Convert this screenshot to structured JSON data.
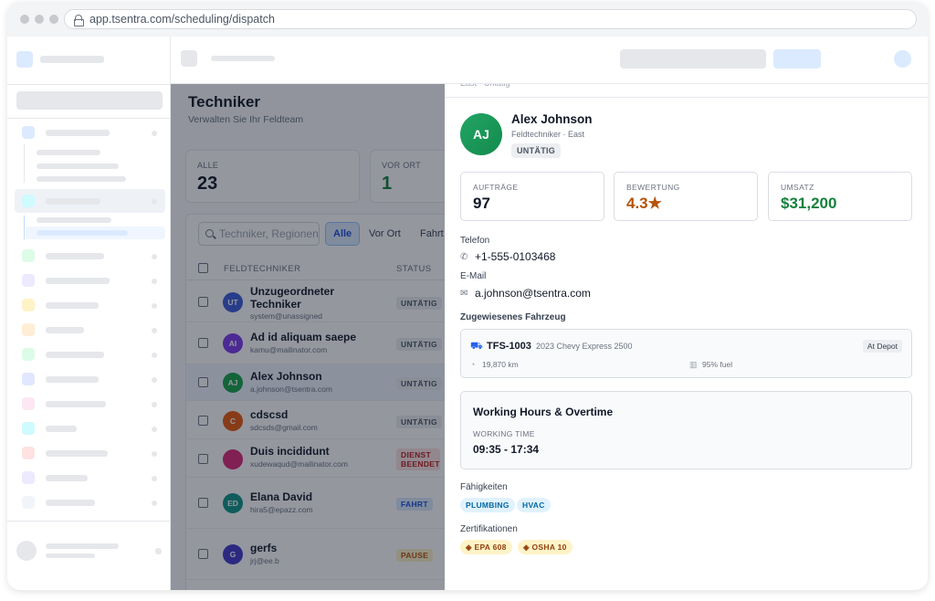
{
  "browser": {
    "url": "app.tsentra.com/scheduling/dispatch"
  },
  "page": {
    "title": "Techniker",
    "subtitle": "Verwalten Sie Ihr Feldteam"
  },
  "stats": [
    {
      "label": "ALLE",
      "value": "23"
    },
    {
      "label": "VOR ORT",
      "value": "1"
    }
  ],
  "search": {
    "placeholder": "Techniker, Regionen"
  },
  "filters": [
    "Alle",
    "Vor Ort",
    "Fahrt"
  ],
  "table": {
    "columns": [
      "FELDTECHNIKER",
      "STATUS"
    ],
    "rows": [
      {
        "initials": "UT",
        "name": "Unzugeordneter Techniker",
        "email": "system@unassigned",
        "status": "UNTÄTIG",
        "avatar_color": "#3b5bdb"
      },
      {
        "initials": "AI",
        "name": "Ad id aliquam saepe",
        "email": "kamu@mailinator.com",
        "status": "UNTÄTIG",
        "avatar_color": "#7c3aed"
      },
      {
        "initials": "AJ",
        "name": "Alex Johnson",
        "email": "a.johnson@tsentra.com",
        "status": "UNTÄTIG",
        "avatar_color": "#16a34a"
      },
      {
        "initials": "C",
        "name": "cdscsd",
        "email": "sdcsds@gmail.com",
        "status": "UNTÄTIG",
        "avatar_color": "#ea580c"
      },
      {
        "initials": "",
        "name": "Duis incididunt",
        "email": "xudewaqud@mailinator.com",
        "status": "DIENST BEENDET",
        "avatar_color": "#db2777"
      },
      {
        "initials": "ED",
        "name": "Elana David",
        "email": "hira5@epazz.com",
        "status": "FAHRT",
        "avatar_color": "#0d9488"
      },
      {
        "initials": "G",
        "name": "gerfs",
        "email": "jrj@ee.b",
        "status": "PAUSE",
        "avatar_color": "#4338ca"
      }
    ]
  },
  "drawer": {
    "header_text": "East · Untätig",
    "initials": "AJ",
    "name": "Alex Johnson",
    "role": "Feldtechniker · East",
    "status": "UNTÄTIG",
    "metrics": [
      {
        "label": "AUFTRÄGE",
        "value": "97",
        "color": "#111827"
      },
      {
        "label": "BEWERTUNG",
        "value": "4.3★",
        "color": "#b45309"
      },
      {
        "label": "UMSATZ",
        "value": "$31,200",
        "color": "#15803d"
      }
    ],
    "phone_label": "Telefon",
    "phone": "+1-555-0103468",
    "email_label": "E-Mail",
    "email": "a.johnson@tsentra.com",
    "vehicle_label": "Zugewiesenes Fahrzeug",
    "vehicle": {
      "id": "TFS-1003",
      "model": "2023 Chevy Express 2500",
      "status": "At Depot",
      "mileage": "19,870 km",
      "fuel": "95% fuel"
    },
    "hours": {
      "title": "Working Hours & Overtime",
      "label": "WORKING TIME",
      "value": "09:35 - 17:34"
    },
    "skills_label": "Fähigkeiten",
    "skills": [
      "PLUMBING",
      "HVAC"
    ],
    "certs_label": "Zertifikationen",
    "certs": [
      "EPA 608",
      "OSHA 10"
    ]
  },
  "colors": {
    "accent": "#3b82f6",
    "success": "#15803d",
    "warning": "#b45309",
    "danger": "#b91c1c"
  },
  "icons": [
    "lock-icon",
    "search-icon",
    "phone-icon",
    "mail-icon",
    "van-icon",
    "gauge-icon",
    "fuel-icon",
    "certificate-icon"
  ]
}
